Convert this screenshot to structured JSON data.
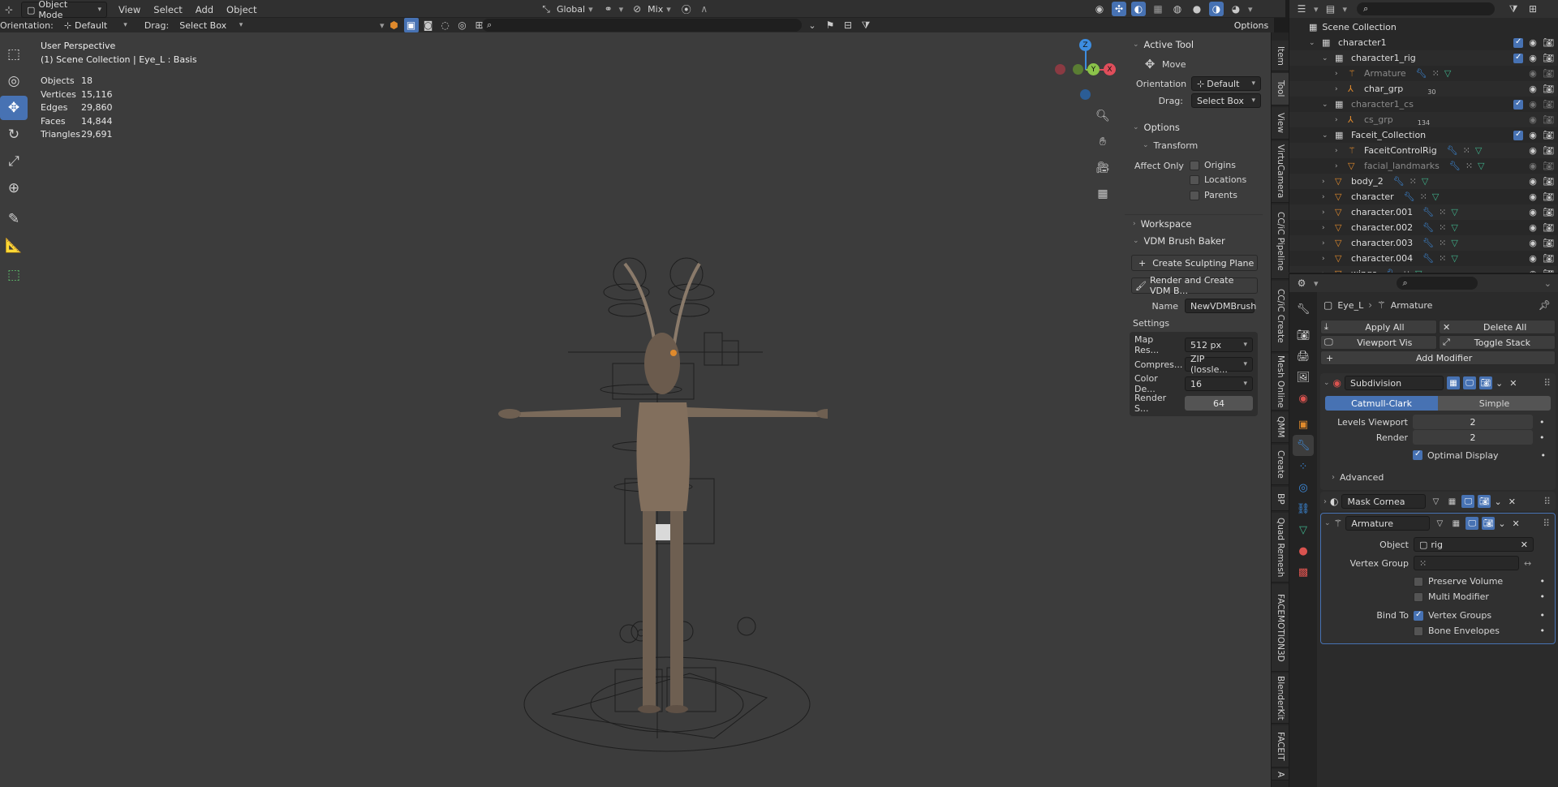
{
  "header": {
    "mode": "Object Mode",
    "menus": [
      "View",
      "Select",
      "Add",
      "Object"
    ],
    "transform_orientation": "Global",
    "pivot_label": "Mix",
    "orientation_label": "Orientation:",
    "orientation_value": "Default",
    "drag_label": "Drag:",
    "drag_value": "Select Box",
    "options_label": "Options"
  },
  "viewport": {
    "perspective": "User Perspective",
    "collection_info": "(1) Scene Collection | Eye_L : Basis",
    "stats": [
      {
        "label": "Objects",
        "value": "18"
      },
      {
        "label": "Vertices",
        "value": "15,116"
      },
      {
        "label": "Edges",
        "value": "29,860"
      },
      {
        "label": "Faces",
        "value": "14,844"
      },
      {
        "label": "Triangles",
        "value": "29,691"
      }
    ],
    "gizmo_labels": {
      "x": "X",
      "y": "Y",
      "z": "Z"
    }
  },
  "tool_panel": {
    "active_tool_title": "Active Tool",
    "tool_name": "Move",
    "orientation_label": "Orientation",
    "orientation_value": "Default",
    "drag_label": "Drag:",
    "drag_value": "Select Box",
    "options_title": "Options",
    "transform_title": "Transform",
    "affect_only_label": "Affect Only",
    "affect_items": [
      "Origins",
      "Locations",
      "Parents"
    ],
    "workspace_title": "Workspace",
    "vdm_title": "VDM Brush Baker",
    "create_plane_label": "Create Sculpting Plane",
    "render_create_label": "Render and Create VDM B...",
    "name_label": "Name",
    "name_value": "NewVDMBrush",
    "settings_label": "Settings",
    "settings": [
      {
        "label": "Map Res...",
        "value": "512 px"
      },
      {
        "label": "Compres...",
        "value": "ZIP (lossle..."
      },
      {
        "label": "Color De...",
        "value": "16"
      },
      {
        "label": "Render S...",
        "value": "64"
      }
    ]
  },
  "side_tabs": [
    "Item",
    "Tool",
    "View",
    "VirtuCamera",
    "CC/iC Pipeline",
    "CC/iC Create",
    "Mesh Online",
    "QMM",
    "Create",
    "BP",
    "Quad Remesh",
    "FACEMOTION3D",
    "BlenderKit",
    "FACEIT",
    "A"
  ],
  "outliner": {
    "root": "Scene Collection",
    "rows": [
      {
        "label": "character1",
        "indent": 1,
        "type": "collection",
        "dim": false
      },
      {
        "label": "character1_rig",
        "indent": 2,
        "type": "collection",
        "dim": false
      },
      {
        "label": "Armature",
        "indent": 3,
        "type": "armature",
        "dim": true
      },
      {
        "label": "char_grp",
        "indent": 3,
        "type": "empty",
        "dim": false
      },
      {
        "label": "character1_cs",
        "indent": 2,
        "type": "collection",
        "dim": true
      },
      {
        "label": "cs_grp",
        "indent": 3,
        "type": "empty",
        "dim": true
      },
      {
        "label": "Faceit_Collection",
        "indent": 2,
        "type": "collection",
        "dim": false
      },
      {
        "label": "FaceitControlRig",
        "indent": 3,
        "type": "armature",
        "dim": false
      },
      {
        "label": "facial_landmarks",
        "indent": 3,
        "type": "mesh",
        "dim": true
      },
      {
        "label": "body_2",
        "indent": 2,
        "type": "mesh",
        "dim": false
      },
      {
        "label": "character",
        "indent": 2,
        "type": "mesh",
        "dim": false
      },
      {
        "label": "character.001",
        "indent": 2,
        "type": "mesh",
        "dim": false
      },
      {
        "label": "character.002",
        "indent": 2,
        "type": "mesh",
        "dim": false
      },
      {
        "label": "character.003",
        "indent": 2,
        "type": "mesh",
        "dim": false
      },
      {
        "label": "character.004",
        "indent": 2,
        "type": "mesh",
        "dim": false
      },
      {
        "label": "wings",
        "indent": 2,
        "type": "mesh",
        "dim": false
      }
    ],
    "badges": {
      "char_grp": "30",
      "cs_grp": "134"
    }
  },
  "properties": {
    "breadcrumb_object": "Eye_L",
    "breadcrumb_modifier": "Armature",
    "apply_all": "Apply All",
    "delete_all": "Delete All",
    "viewport_vis": "Viewport Vis",
    "toggle_stack": "Toggle Stack",
    "add_modifier": "Add Modifier",
    "subdivision": {
      "name": "Subdivision",
      "mode_a": "Catmull-Clark",
      "mode_b": "Simple",
      "levels_label": "Levels Viewport",
      "levels_value": "2",
      "render_label": "Render",
      "render_value": "2",
      "optimal_label": "Optimal Display",
      "advanced_label": "Advanced"
    },
    "mask": {
      "name": "Mask Cornea"
    },
    "armature": {
      "name": "Armature",
      "object_label": "Object",
      "object_value": "rig",
      "vgroup_label": "Vertex Group",
      "preserve_volume": "Preserve Volume",
      "multi_modifier": "Multi Modifier",
      "bind_to_label": "Bind To",
      "vertex_groups": "Vertex Groups",
      "bone_envelopes": "Bone Envelopes"
    }
  },
  "colors": {
    "accent": "#4772b3",
    "orange": "#e08a2c",
    "green": "#3fb08a",
    "axis_x": "#e04e5b",
    "axis_y": "#8bc34a",
    "axis_z": "#3d8de0"
  }
}
